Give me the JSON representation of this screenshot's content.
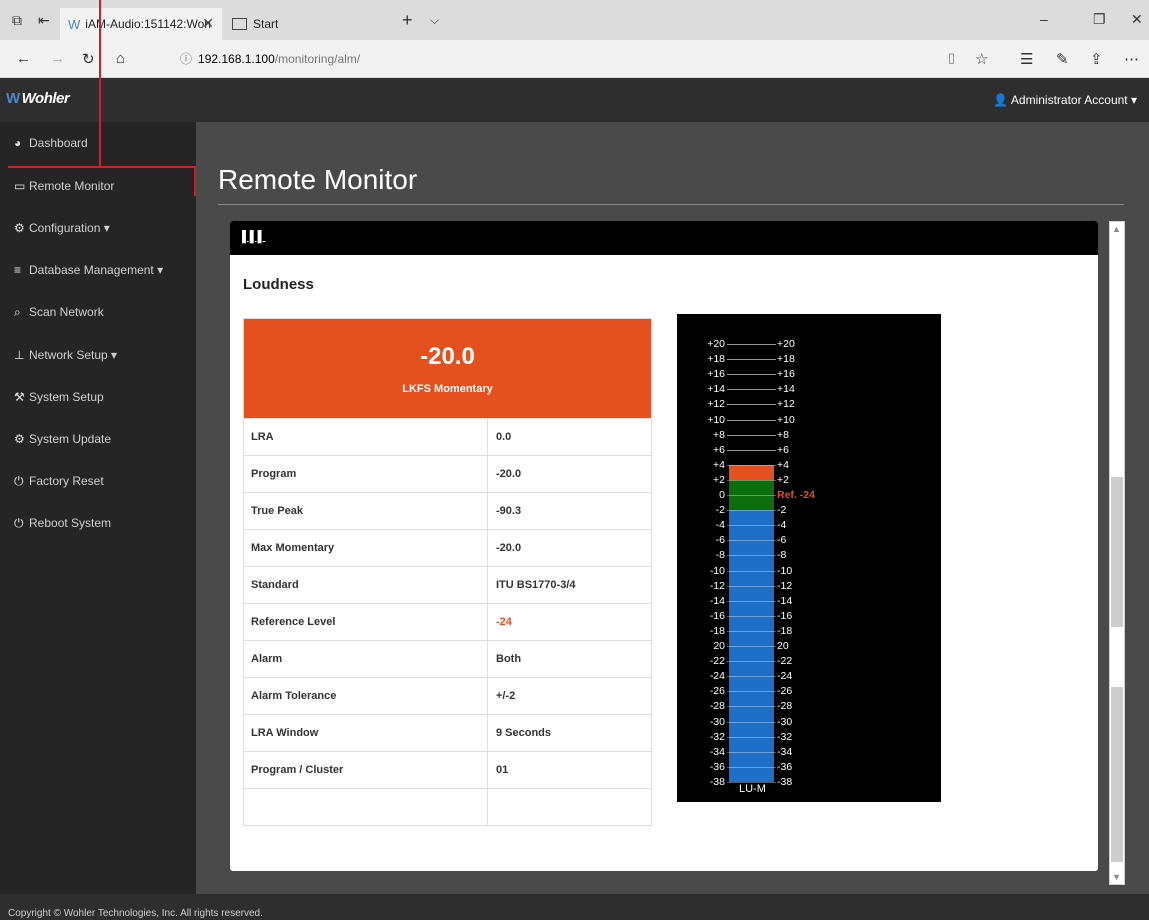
{
  "browser": {
    "active_tab_title": "iAM-Audio:151142:Woh",
    "other_tab_title": "Start",
    "url_host": "192.168.1.100",
    "url_path": "/monitoring/alm/"
  },
  "header": {
    "brand": "Wohler",
    "account_label": "Administrator Account"
  },
  "sidebar": {
    "items": [
      {
        "label": "Dashboard",
        "icon": "dashboard-icon"
      },
      {
        "label": "Remote Monitor",
        "icon": "monitor-icon"
      },
      {
        "label": "Configuration",
        "icon": "cogs-icon"
      },
      {
        "label": "Database Management",
        "icon": "database-icon"
      },
      {
        "label": "Scan Network",
        "icon": "search-icon"
      },
      {
        "label": "Network Setup",
        "icon": "sitemap-icon"
      },
      {
        "label": "System Setup",
        "icon": "wrench-icon"
      },
      {
        "label": "System Update",
        "icon": "gear-icon"
      },
      {
        "label": "Factory Reset",
        "icon": "power-icon"
      },
      {
        "label": "Reboot System",
        "icon": "power-icon"
      }
    ]
  },
  "main": {
    "page_title": "Remote Monitor",
    "section_title": "Loudness",
    "momentary_value": "-20.0",
    "momentary_unit": "LKFS Momentary",
    "rows": [
      {
        "key": "LRA",
        "value": "0.0"
      },
      {
        "key": "Program",
        "value": "-20.0"
      },
      {
        "key": "True Peak",
        "value": "-90.3"
      },
      {
        "key": "Max Momentary",
        "value": "-20.0"
      },
      {
        "key": "Standard",
        "value": "ITU BS1770-3/4"
      },
      {
        "key": "Reference Level",
        "value": "-24"
      },
      {
        "key": "Alarm",
        "value": "Both"
      },
      {
        "key": "Alarm Tolerance",
        "value": "+/-2"
      },
      {
        "key": "LRA Window",
        "value": "9 Seconds"
      },
      {
        "key": "Program / Cluster",
        "value": "01"
      }
    ]
  },
  "meter": {
    "scale_labels": [
      "+20",
      "+18",
      "+16",
      "+14",
      "+12",
      "+10",
      "+8",
      "+6",
      "+4",
      "+2",
      "0",
      "-2",
      "-4",
      "-6",
      "-8",
      "-10",
      "-12",
      "-14",
      "-16",
      "-18",
      "20",
      "-22",
      "-24",
      "-26",
      "-28",
      "-30",
      "-32",
      "-34",
      "-36",
      "-38"
    ],
    "right_zero_label": "Ref. -24",
    "unit_label": "LU-M",
    "level_lu": 4,
    "colors": {
      "over": "#e4501e",
      "target": "#0d6e0d",
      "normal": "#1e6fc8"
    }
  },
  "footer": {
    "copyright": "Copyright © Wohler Technologies, Inc. All rights reserved."
  }
}
